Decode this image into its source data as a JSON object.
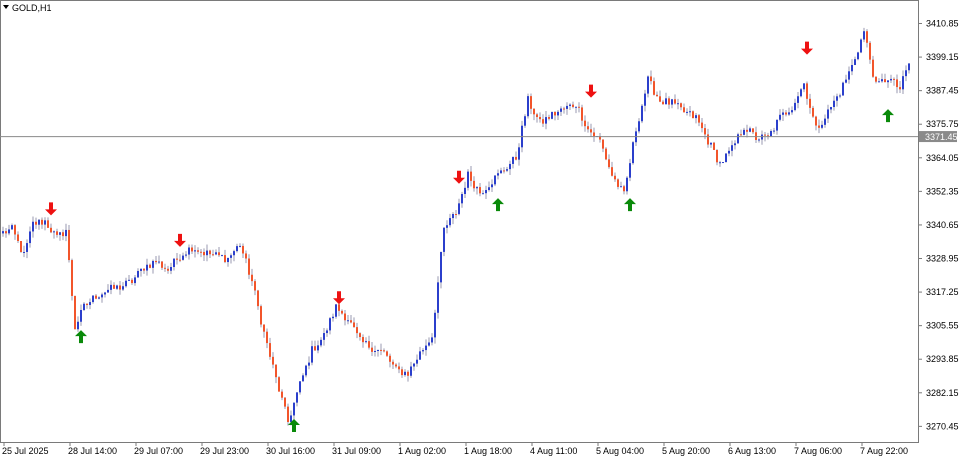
{
  "window": {
    "symbol_label": "GOLD,H1",
    "current_price_label": "3371.45"
  },
  "colors": {
    "background": "#ffffff",
    "bull_candle": "#2b3fcc",
    "bear_candle": "#f2552b",
    "wick": "#9a9ab0",
    "buy_arrow": "#0a8a0a",
    "sell_arrow": "#ee1111",
    "price_line": "#8a8a8a",
    "price_tag": "#8a8a8a"
  },
  "chart_data": {
    "type": "candlestick",
    "title": "GOLD,H1",
    "ylim": [
      3265,
      3418
    ],
    "current_price": 3371.45,
    "y_ticks": [
      "3410.85",
      "3399.15",
      "3387.45",
      "3375.75",
      "3364.05",
      "3352.35",
      "3340.65",
      "3328.95",
      "3317.25",
      "3305.55",
      "3293.85",
      "3282.15",
      "3270.45"
    ],
    "x_ticks": [
      "25 Jul 2025",
      "28 Jul 14:00",
      "29 Jul 07:00",
      "29 Jul 23:00",
      "30 Jul 16:00",
      "31 Jul 09:00",
      "1 Aug 02:00",
      "1 Aug 18:00",
      "4 Aug 11:00",
      "5 Aug 04:00",
      "5 Aug 20:00",
      "6 Aug 13:00",
      "7 Aug 06:00",
      "7 Aug 22:00"
    ],
    "anchors": [
      [
        0,
        3338
      ],
      [
        3,
        3339
      ],
      [
        7,
        3330
      ],
      [
        10,
        3341
      ],
      [
        14,
        3342
      ],
      [
        18,
        3336
      ],
      [
        21,
        3339
      ],
      [
        24,
        3305
      ],
      [
        27,
        3312
      ],
      [
        31,
        3316
      ],
      [
        35,
        3318
      ],
      [
        39,
        3319
      ],
      [
        43,
        3321
      ],
      [
        47,
        3326
      ],
      [
        51,
        3328
      ],
      [
        55,
        3325
      ],
      [
        59,
        3330
      ],
      [
        63,
        3333
      ],
      [
        67,
        3331
      ],
      [
        71,
        3330
      ],
      [
        75,
        3329
      ],
      [
        79,
        3334
      ],
      [
        83,
        3321
      ],
      [
        87,
        3303
      ],
      [
        91,
        3287
      ],
      [
        95,
        3272
      ],
      [
        99,
        3285
      ],
      [
        103,
        3297
      ],
      [
        107,
        3302
      ],
      [
        111,
        3312
      ],
      [
        115,
        3308
      ],
      [
        119,
        3300
      ],
      [
        123,
        3298
      ],
      [
        127,
        3296
      ],
      [
        131,
        3290
      ],
      [
        135,
        3289
      ],
      [
        139,
        3296
      ],
      [
        143,
        3302
      ],
      [
        147,
        3339
      ],
      [
        151,
        3345
      ],
      [
        155,
        3358
      ],
      [
        159,
        3352
      ],
      [
        163,
        3356
      ],
      [
        167,
        3360
      ],
      [
        171,
        3364
      ],
      [
        175,
        3384
      ],
      [
        179,
        3376
      ],
      [
        183,
        3379
      ],
      [
        187,
        3381
      ],
      [
        191,
        3383
      ],
      [
        195,
        3374
      ],
      [
        199,
        3370
      ],
      [
        203,
        3358
      ],
      [
        207,
        3351
      ],
      [
        211,
        3374
      ],
      [
        215,
        3391
      ],
      [
        219,
        3384
      ],
      [
        223,
        3383
      ],
      [
        227,
        3380
      ],
      [
        231,
        3378
      ],
      [
        235,
        3370
      ],
      [
        239,
        3362
      ],
      [
        243,
        3367
      ],
      [
        247,
        3375
      ],
      [
        251,
        3371
      ],
      [
        255,
        3371
      ],
      [
        259,
        3378
      ],
      [
        263,
        3382
      ],
      [
        267,
        3390
      ],
      [
        271,
        3374
      ],
      [
        275,
        3380
      ],
      [
        279,
        3387
      ],
      [
        283,
        3396
      ],
      [
        287,
        3408
      ],
      [
        291,
        3389
      ],
      [
        295,
        3392
      ],
      [
        299,
        3388
      ],
      [
        302,
        3397
      ]
    ],
    "signals": [
      {
        "type": "sell",
        "bar": 16,
        "price": 3344
      },
      {
        "type": "buy",
        "bar": 26,
        "price": 3304
      },
      {
        "type": "sell",
        "bar": 59,
        "price": 3333
      },
      {
        "type": "buy",
        "bar": 97,
        "price": 3273
      },
      {
        "type": "sell",
        "bar": 112,
        "price": 3313
      },
      {
        "type": "sell",
        "bar": 152,
        "price": 3355
      },
      {
        "type": "buy",
        "bar": 165,
        "price": 3350
      },
      {
        "type": "sell",
        "bar": 196,
        "price": 3385
      },
      {
        "type": "buy",
        "bar": 209,
        "price": 3350
      },
      {
        "type": "sell",
        "bar": 268,
        "price": 3400
      },
      {
        "type": "buy",
        "bar": 295,
        "price": 3381
      }
    ]
  }
}
